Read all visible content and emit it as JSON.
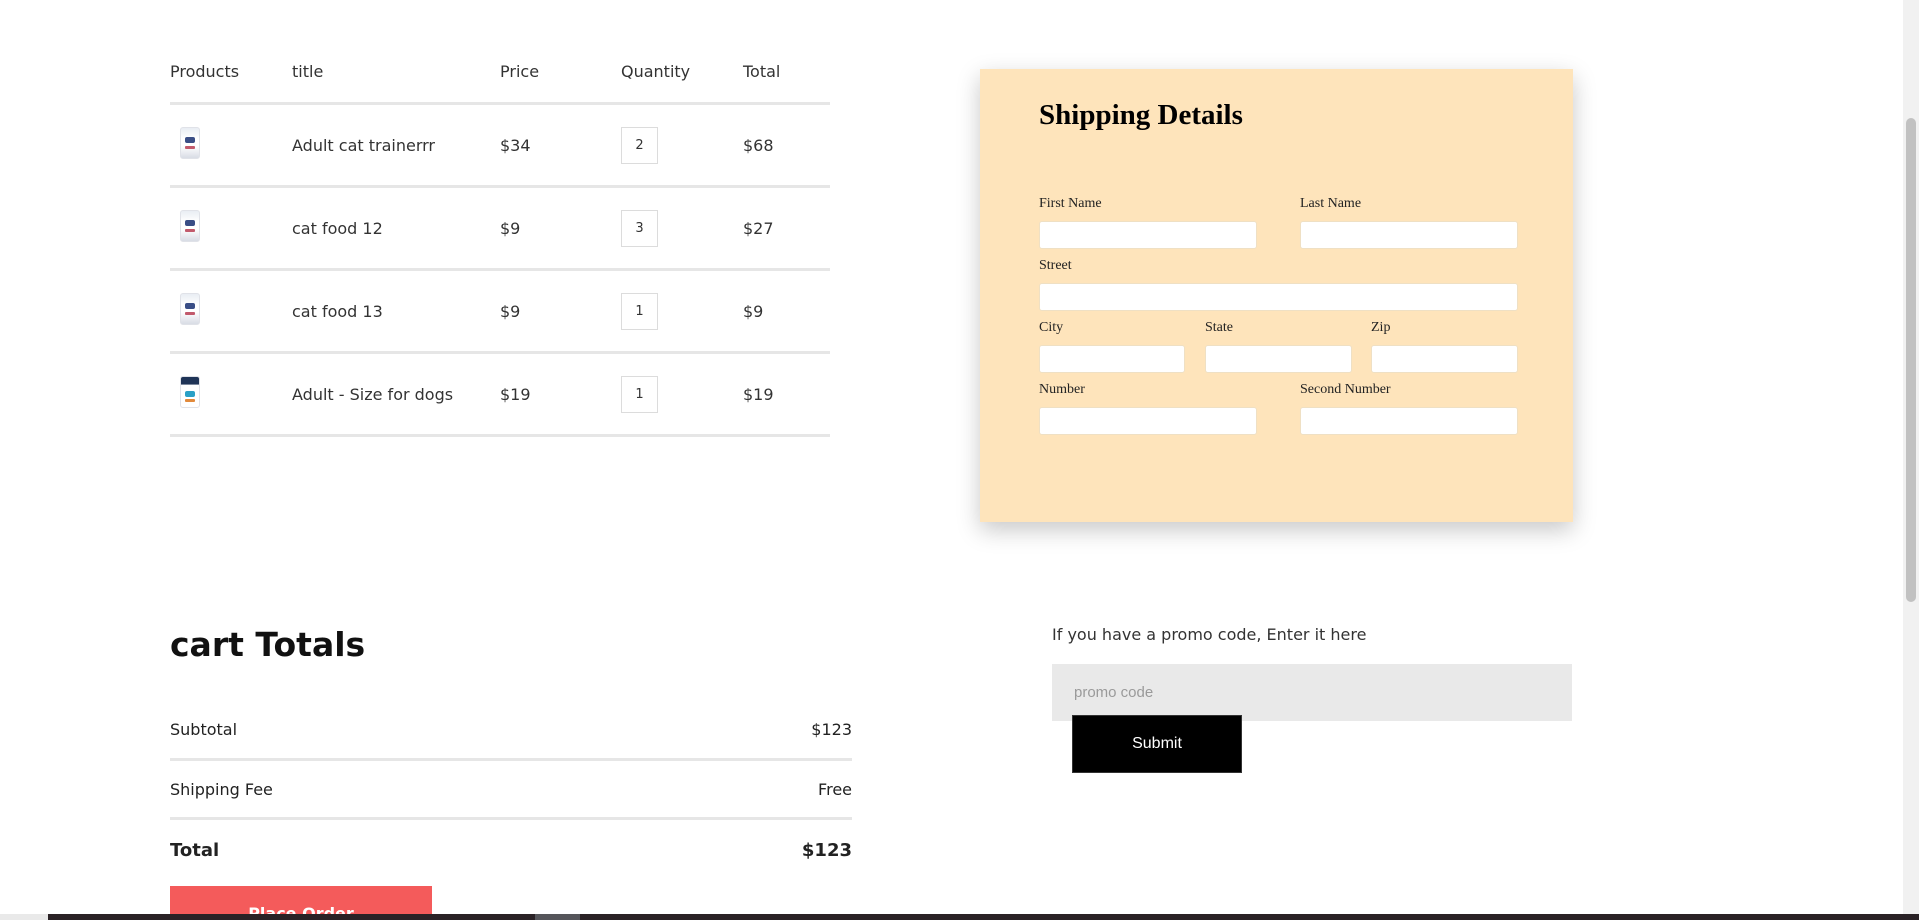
{
  "cart": {
    "headers": {
      "products": "Products",
      "title": "title",
      "price": "Price",
      "quantity": "Quantity",
      "total": "Total"
    },
    "items": [
      {
        "image_icon": "cat-food-bag-icon",
        "title": "Adult cat trainerrr",
        "price": "$34",
        "quantity": "2",
        "total": "$68"
      },
      {
        "image_icon": "cat-food-bag-icon",
        "title": "cat food 12",
        "price": "$9",
        "quantity": "3",
        "total": "$27"
      },
      {
        "image_icon": "cat-food-bag-icon",
        "title": "cat food 13",
        "price": "$9",
        "quantity": "1",
        "total": "$9"
      },
      {
        "image_icon": "dog-food-bag-icon",
        "title": "Adult - Size for dogs",
        "price": "$19",
        "quantity": "1",
        "total": "$19"
      }
    ]
  },
  "shipping": {
    "title": "Shipping Details",
    "first_name_label": "First Name",
    "last_name_label": "Last Name",
    "street_label": "Street",
    "city_label": "City",
    "state_label": "State",
    "zip_label": "Zip",
    "number_label": "Number",
    "second_number_label": "Second Number",
    "first_name_value": "",
    "last_name_value": "",
    "street_value": "",
    "city_value": "",
    "state_value": "",
    "zip_value": "",
    "number_value": "",
    "second_number_value": "",
    "background_color": "#fee4bb"
  },
  "totals": {
    "title": "cart Totals",
    "subtotal_label": "Subtotal",
    "subtotal_value": "$123",
    "shipping_label": "Shipping Fee",
    "shipping_value": "Free",
    "total_label": "Total",
    "total_value": "$123",
    "place_order_label": "Place Order",
    "place_order_color": "#f45b5b"
  },
  "promo": {
    "label": "If you have a promo code, Enter it here",
    "placeholder": "promo code",
    "value": "",
    "submit_label": "Submit"
  }
}
